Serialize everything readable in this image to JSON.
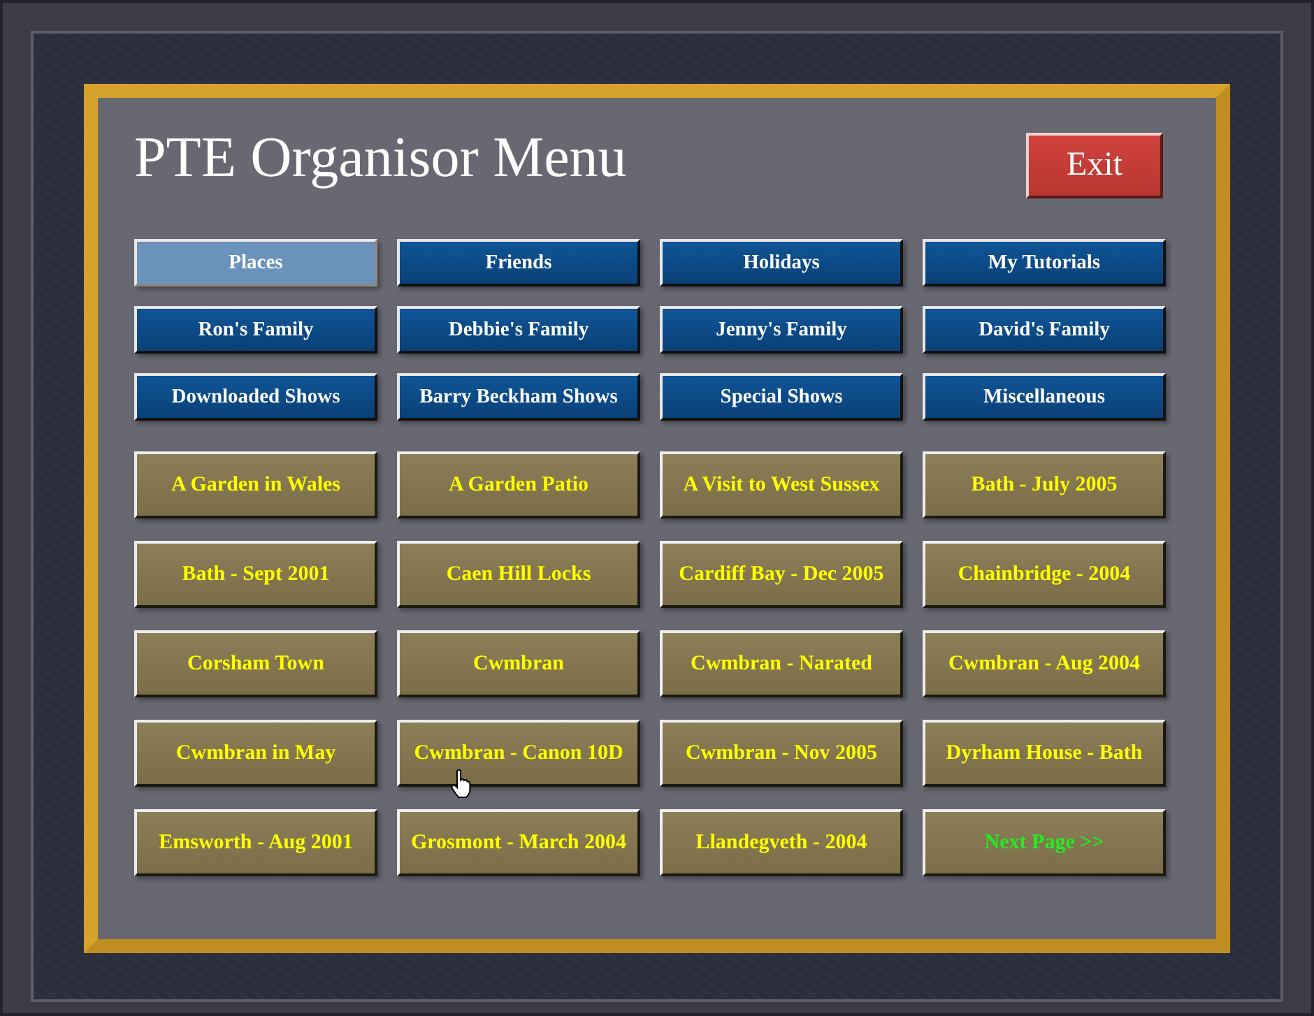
{
  "title": "PTE Organisor Menu",
  "exit_button": {
    "label": "Exit"
  },
  "categories": [
    {
      "label": "Places",
      "selected": true
    },
    {
      "label": "Friends",
      "selected": false
    },
    {
      "label": "Holidays",
      "selected": false
    },
    {
      "label": "My Tutorials",
      "selected": false
    },
    {
      "label": "Ron's Family",
      "selected": false
    },
    {
      "label": "Debbie's Family",
      "selected": false
    },
    {
      "label": "Jenny's Family",
      "selected": false
    },
    {
      "label": "David's Family",
      "selected": false
    },
    {
      "label": "Downloaded Shows",
      "selected": false
    },
    {
      "label": "Barry Beckham Shows",
      "selected": false
    },
    {
      "label": "Special Shows",
      "selected": false
    },
    {
      "label": "Miscellaneous",
      "selected": false
    }
  ],
  "shows": [
    {
      "label": "A Garden in Wales",
      "kind": "show"
    },
    {
      "label": "A Garden Patio",
      "kind": "show"
    },
    {
      "label": "A Visit to West Sussex",
      "kind": "show"
    },
    {
      "label": "Bath - July 2005",
      "kind": "show"
    },
    {
      "label": "Bath - Sept 2001",
      "kind": "show"
    },
    {
      "label": "Caen Hill Locks",
      "kind": "show"
    },
    {
      "label": "Cardiff Bay - Dec 2005",
      "kind": "show"
    },
    {
      "label": "Chainbridge - 2004",
      "kind": "show"
    },
    {
      "label": "Corsham Town",
      "kind": "show"
    },
    {
      "label": "Cwmbran",
      "kind": "show"
    },
    {
      "label": "Cwmbran - Narated",
      "kind": "show"
    },
    {
      "label": "Cwmbran - Aug 2004",
      "kind": "show"
    },
    {
      "label": "Cwmbran in May",
      "kind": "show"
    },
    {
      "label": "Cwmbran - Canon 10D",
      "kind": "show"
    },
    {
      "label": "Cwmbran - Nov 2005",
      "kind": "show"
    },
    {
      "label": "Dyrham House - Bath",
      "kind": "show"
    },
    {
      "label": "Emsworth - Aug 2001",
      "kind": "show"
    },
    {
      "label": "Grosmont - March 2004",
      "kind": "show"
    },
    {
      "label": "Llandegveth - 2004",
      "kind": "show"
    },
    {
      "label": "Next Page >>",
      "kind": "next"
    }
  ]
}
